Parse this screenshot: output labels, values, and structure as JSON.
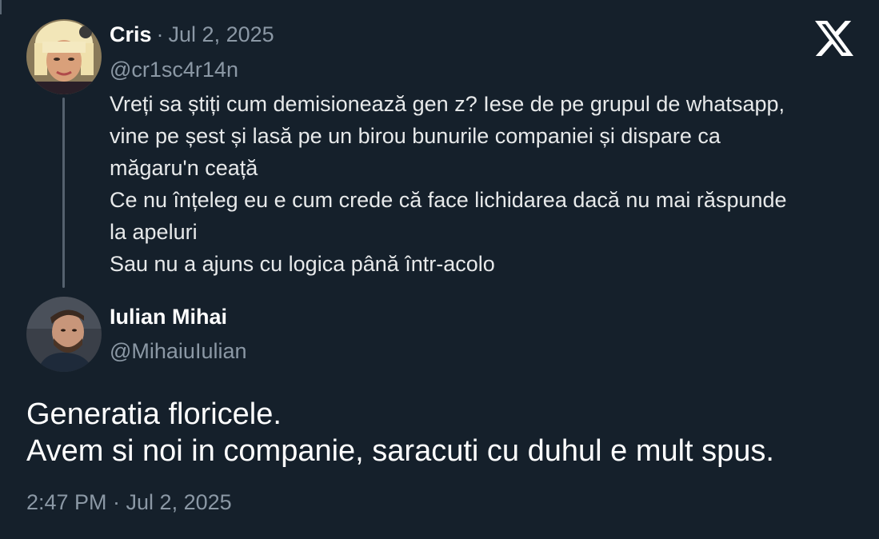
{
  "quoted_tweet": {
    "author_name": "Cris",
    "separator": "·",
    "date": "Jul 2, 2025",
    "handle": "@cr1sc4r14n",
    "text_lines": [
      "Vreți sa știți cum demisionează gen z? Iese de pe grupul de whatsapp,",
      "vine pe șest și lasă pe un birou bunurile companiei și dispare ca",
      "măgaru'n ceață",
      "Ce nu înțeleg eu e cum crede că face lichidarea dacă nu mai răspunde",
      "la apeluri",
      "Sau nu a ajuns cu logica până într-acolo"
    ],
    "avatar_icon": "user-avatar-blonde-woman"
  },
  "reply_tweet": {
    "author_name": "Iulian Mihai",
    "handle": "@MihaiuIulian",
    "text_lines": [
      "Generatia floricele.",
      "Avem si noi in companie, saracuti cu duhul e mult spus."
    ],
    "timestamp": "2:47 PM · Jul 2, 2025",
    "avatar_icon": "user-avatar-bearded-man"
  },
  "brand": {
    "logo_icon": "x-logo-icon"
  },
  "colors": {
    "background": "#15202b",
    "primary_text": "#ffffff",
    "secondary_text": "#8b98a5"
  }
}
